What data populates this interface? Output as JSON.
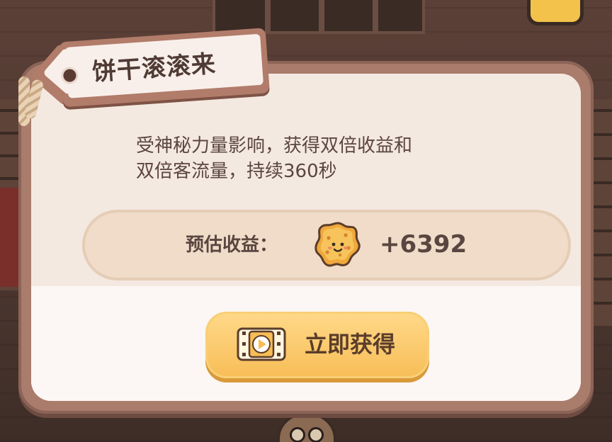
{
  "dialog": {
    "title": "饼干滚滚来",
    "description_line1": "受神秘力量影响，获得双倍收益和",
    "description_line2": "双倍客流量，持续360秒",
    "earnings_label": "预估收益：",
    "earnings_value": "+6392",
    "earnings_icon": "cookie-coin-icon",
    "action_button_label": "立即获得",
    "action_button_icon": "video-play-icon"
  },
  "colors": {
    "frame": "#a97c6c",
    "panel": "#f4e9e1",
    "pill": "#f0dcc8",
    "button": "#f7bd56",
    "text": "#5b4540"
  }
}
